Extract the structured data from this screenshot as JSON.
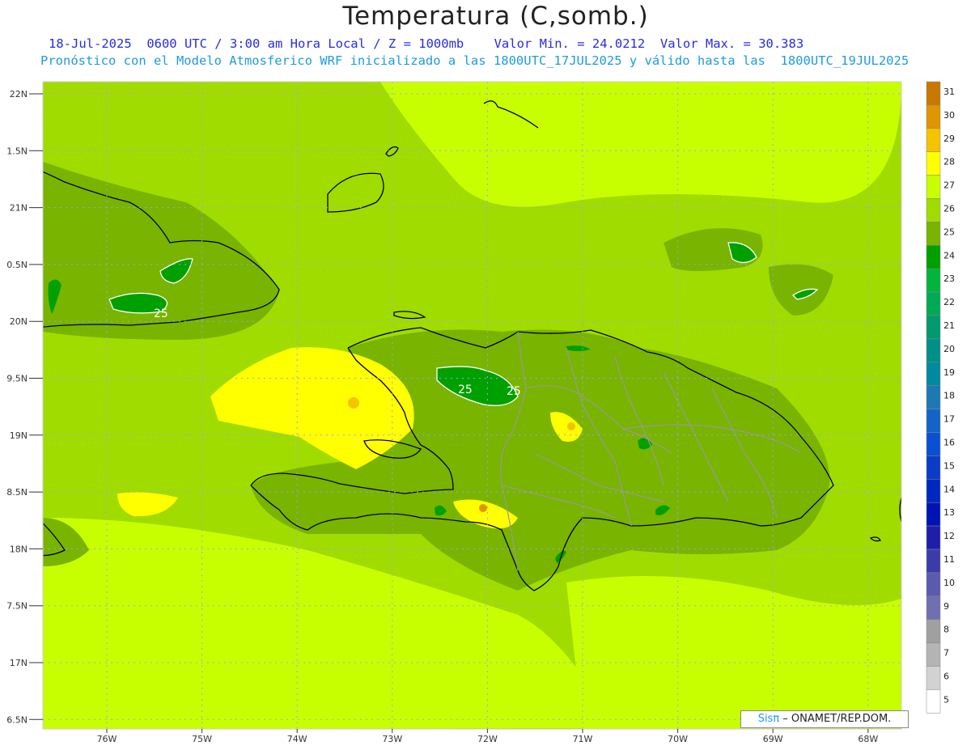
{
  "header": {
    "title": "Temperatura (C,somb.)",
    "line1": "18-Jul-2025  0600 UTC / 3:00 am Hora Local / Z = 1000mb    Valor Min. = 24.0212  Valor Max. = 30.383",
    "line2": "Pronóstico con el Modelo Atmosferico WRF inicializado a las 1800UTC_17JUL2025 y válido hasta las  1800UTC_19JUL2025"
  },
  "map": {
    "lat_labels": [
      "22N",
      "1.5N",
      "21N",
      "0.5N",
      "20N",
      "9.5N",
      "19N",
      "8.5N",
      "18N",
      "7.5N",
      "17N",
      "6.5N"
    ],
    "lon_labels": [
      "76W",
      "75W",
      "74W",
      "73W",
      "72W",
      "71W",
      "70W",
      "69W",
      "68W"
    ],
    "contour_labels": [
      "25",
      "25",
      "25"
    ]
  },
  "colorbar": {
    "levels": [
      "31",
      "30",
      "29",
      "28",
      "27",
      "26",
      "25",
      "24",
      "23",
      "22",
      "21",
      "20",
      "19",
      "18",
      "17",
      "16",
      "15",
      "14",
      "13",
      "12",
      "11",
      "10",
      "9",
      "8",
      "7",
      "6",
      "5"
    ],
    "colors": [
      "#c87800",
      "#e09600",
      "#f5c300",
      "#ffff00",
      "#c8ff00",
      "#a0dc00",
      "#78b400",
      "#00a000",
      "#00b43c",
      "#00aa55",
      "#009a6e",
      "#009088",
      "#008aa0",
      "#1e78b4",
      "#1464c8",
      "#0a50d2",
      "#0a3cc8",
      "#0028c0",
      "#0014b4",
      "#1e1eaa",
      "#3c3ca8",
      "#5a5ab0",
      "#7070b0",
      "#a0a0a0",
      "#b4b4b4",
      "#d2d2d2",
      "#ffffff"
    ]
  },
  "credit": {
    "sis": "Sisπ",
    "text": " – ONAMET/REP.DOM."
  }
}
